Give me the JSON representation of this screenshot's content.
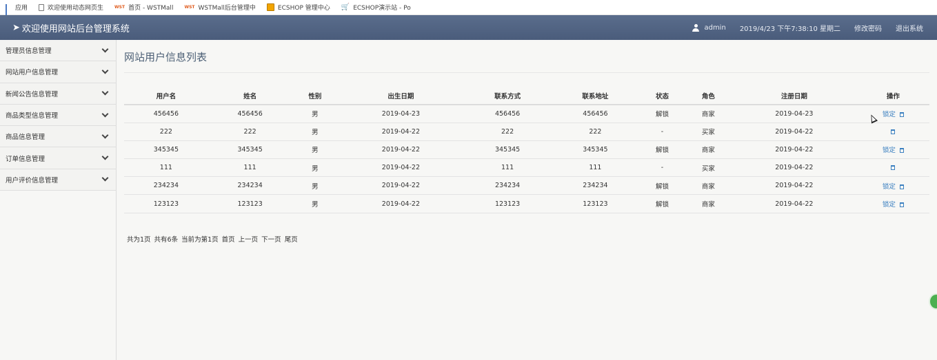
{
  "bookmarks": [
    {
      "icon": "apps-icon",
      "label": "应用"
    },
    {
      "icon": "page-icon",
      "label": "欢迎使用动态网页生"
    },
    {
      "icon": "wst-icon",
      "label": "首页 - WSTMall"
    },
    {
      "icon": "wst-icon",
      "label": "WSTMall后台管理中"
    },
    {
      "icon": "ecshop-icon",
      "label": "ECSHOP 管理中心"
    },
    {
      "icon": "cart-icon",
      "label": "ECSHOP演示站 - Po"
    }
  ],
  "header": {
    "title": "欢迎使用网站后台管理系统",
    "user": "admin",
    "datetime": "2019/4/23 下午7:38:10 星期二",
    "change_password": "修改密码",
    "logout": "退出系统",
    "color": "#4f6282"
  },
  "sidebar": {
    "items": [
      {
        "label": "管理员信息管理"
      },
      {
        "label": "网站用户信息管理"
      },
      {
        "label": "新闻公告信息管理"
      },
      {
        "label": "商品类型信息管理"
      },
      {
        "label": "商品信息管理"
      },
      {
        "label": "订单信息管理"
      },
      {
        "label": "用户评价信息管理"
      }
    ]
  },
  "main": {
    "title": "网站用户信息列表",
    "columns": [
      "用户名",
      "姓名",
      "性别",
      "出生日期",
      "联系方式",
      "联系地址",
      "状态",
      "角色",
      "注册日期",
      "操作"
    ],
    "rows": [
      {
        "username": "456456",
        "name": "456456",
        "gender": "男",
        "birth": "2019-04-23",
        "phone": "456456",
        "address": "456456",
        "status": "解锁",
        "role": "商家",
        "reg_date": "2019-04-23",
        "action": "锁定"
      },
      {
        "username": "222",
        "name": "222",
        "gender": "男",
        "birth": "2019-04-22",
        "phone": "222",
        "address": "222",
        "status": "-",
        "role": "买家",
        "reg_date": "2019-04-22",
        "action": ""
      },
      {
        "username": "345345",
        "name": "345345",
        "gender": "男",
        "birth": "2019-04-22",
        "phone": "345345",
        "address": "345345",
        "status": "解锁",
        "role": "商家",
        "reg_date": "2019-04-22",
        "action": "锁定"
      },
      {
        "username": "111",
        "name": "111",
        "gender": "男",
        "birth": "2019-04-22",
        "phone": "111",
        "address": "111",
        "status": "-",
        "role": "买家",
        "reg_date": "2019-04-22",
        "action": ""
      },
      {
        "username": "234234",
        "name": "234234",
        "gender": "男",
        "birth": "2019-04-22",
        "phone": "234234",
        "address": "234234",
        "status": "解锁",
        "role": "商家",
        "reg_date": "2019-04-22",
        "action": "锁定"
      },
      {
        "username": "123123",
        "name": "123123",
        "gender": "男",
        "birth": "2019-04-22",
        "phone": "123123",
        "address": "123123",
        "status": "解锁",
        "role": "商家",
        "reg_date": "2019-04-22",
        "action": "锁定"
      }
    ],
    "pager": {
      "total_pages": "共为1页",
      "total_records": "共有6条",
      "current": "当前为第1页",
      "first": "首页",
      "prev": "上一页",
      "next": "下一页",
      "last": "尾页"
    }
  }
}
